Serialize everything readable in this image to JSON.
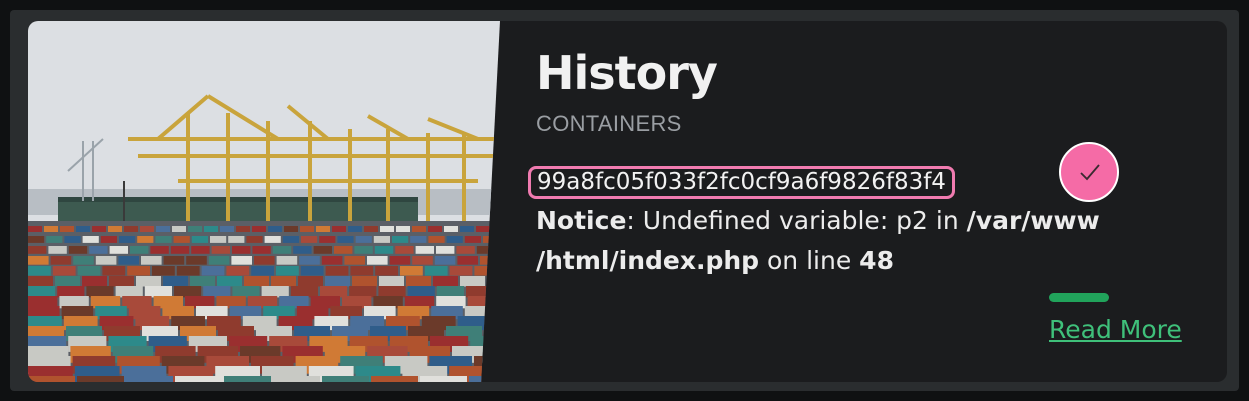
{
  "card": {
    "title": "History",
    "category": "CONTAINERS",
    "hash": "99a8fc05f033f2fc0cf9a6f9826f83f4",
    "notice": {
      "label": "Notice",
      "sep": ": ",
      "message": "Undefined variable: p2 in ",
      "path": "/var/www /html/index.php",
      "on_line": " on line ",
      "line": "48"
    },
    "read_more": "Read More"
  },
  "colors": {
    "accent_pink": "#f56ba6",
    "accent_green": "#21a35b",
    "link_green": "#3fc07a",
    "card_bg": "#1b1c1e"
  },
  "icons": {
    "check": "check-icon",
    "photo": "container-port-image"
  }
}
